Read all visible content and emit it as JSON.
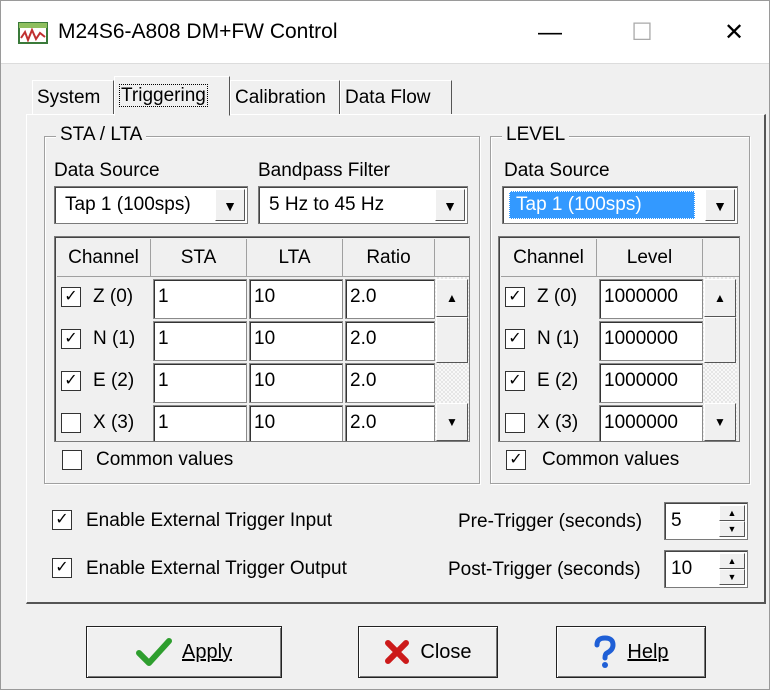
{
  "window": {
    "title": "M24S6-A808 DM+FW Control",
    "minimize": "—",
    "maximize": "☐",
    "close": "✕"
  },
  "tabs": [
    {
      "label": "System"
    },
    {
      "label": "Triggering",
      "selected": true
    },
    {
      "label": "Calibration"
    },
    {
      "label": "Data Flow"
    }
  ],
  "sta_lta": {
    "title": "STA / LTA",
    "data_source_label": "Data Source",
    "data_source_value": "Tap 1 (100sps)",
    "filter_label": "Bandpass Filter",
    "filter_value": "5 Hz to 45 Hz",
    "columns": [
      "Channel",
      "STA",
      "LTA",
      "Ratio"
    ],
    "rows": [
      {
        "checked": true,
        "channel": "Z (0)",
        "sta": "1",
        "lta": "10",
        "ratio": "2.0"
      },
      {
        "checked": true,
        "channel": "N (1)",
        "sta": "1",
        "lta": "10",
        "ratio": "2.0"
      },
      {
        "checked": true,
        "channel": "E (2)",
        "sta": "1",
        "lta": "10",
        "ratio": "2.0"
      },
      {
        "checked": false,
        "channel": "X (3)",
        "sta": "1",
        "lta": "10",
        "ratio": "2.0"
      }
    ],
    "common_values_label": "Common values",
    "common_values_checked": false
  },
  "level": {
    "title": "LEVEL",
    "data_source_label": "Data Source",
    "data_source_value": "Tap 1 (100sps)",
    "columns": [
      "Channel",
      "Level"
    ],
    "rows": [
      {
        "checked": true,
        "channel": "Z (0)",
        "level": "1000000"
      },
      {
        "checked": true,
        "channel": "N (1)",
        "level": "1000000"
      },
      {
        "checked": true,
        "channel": "E (2)",
        "level": "1000000"
      },
      {
        "checked": false,
        "channel": "X (3)",
        "level": "1000000"
      }
    ],
    "common_values_label": "Common values",
    "common_values_checked": true
  },
  "external": {
    "input_label": "Enable External Trigger Input",
    "input_checked": true,
    "output_label": "Enable External Trigger Output",
    "output_checked": true,
    "pre_trigger_label": "Pre-Trigger (seconds)",
    "pre_trigger_value": "5",
    "post_trigger_label": "Post-Trigger (seconds)",
    "post_trigger_value": "10"
  },
  "buttons": {
    "apply_label": "Apply",
    "close_label": "Close",
    "help_label": "Help"
  },
  "colors": {
    "selection": "#3399ff",
    "apply_icon": "#2e9e2e",
    "close_icon": "#cc1a1a",
    "help_icon": "#1f5fd6"
  }
}
